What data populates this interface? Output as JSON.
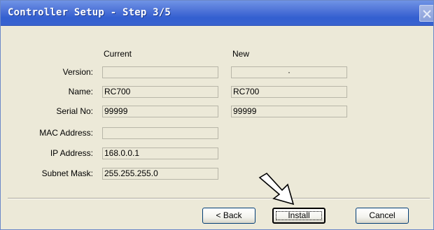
{
  "window": {
    "title": "Controller Setup - Step 3/5"
  },
  "columns": {
    "current": "Current",
    "new": "New"
  },
  "fields": [
    {
      "label": "Version:",
      "current": "",
      "new": "·"
    },
    {
      "label": "Name:",
      "current": "RC700",
      "new": "RC700"
    },
    {
      "label": "Serial No:",
      "current": "99999",
      "new": "99999"
    },
    {
      "label": "MAC Address:",
      "current": ""
    },
    {
      "label": "IP Address:",
      "current": "168.0.0.1"
    },
    {
      "label": "Subnet Mask:",
      "current": "255.255.255.0"
    }
  ],
  "buttons": {
    "back": "< Back",
    "install": "Install",
    "cancel": "Cancel"
  },
  "icons": {
    "close": "close-icon",
    "pointer": "arrow-pointer-icon"
  },
  "colors": {
    "titlebar": "#3a63cf",
    "dialog": "#ece9d8"
  }
}
